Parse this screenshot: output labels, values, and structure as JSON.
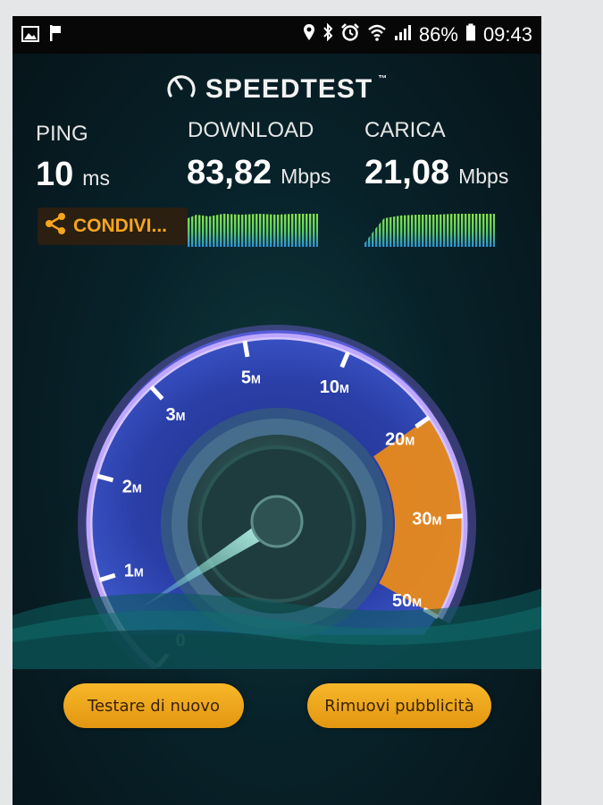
{
  "status_bar": {
    "battery": "86%",
    "time": "09:43",
    "left_icons": [
      "image-icon",
      "flag-icon"
    ],
    "right_icons": [
      "location-icon",
      "bluetooth-icon",
      "alarm-icon",
      "wifi-icon",
      "signal-icon",
      "battery-icon"
    ]
  },
  "brand": {
    "name": "SPEEDTEST",
    "mark": "™"
  },
  "metrics": {
    "ping": {
      "label": "PING",
      "value": "10",
      "unit": "ms"
    },
    "download": {
      "label": "DOWNLOAD",
      "value": "83,82",
      "unit": "Mbps"
    },
    "upload": {
      "label": "CARICA",
      "value": "21,08",
      "unit": "Mbps"
    }
  },
  "share": {
    "label": "CONDIVI..."
  },
  "gauge": {
    "ticks": [
      {
        "value": "0",
        "unit": ""
      },
      {
        "value": "1",
        "unit": "M"
      },
      {
        "value": "2",
        "unit": "M"
      },
      {
        "value": "3",
        "unit": "M"
      },
      {
        "value": "5",
        "unit": "M"
      },
      {
        "value": "10",
        "unit": "M"
      },
      {
        "value": "20",
        "unit": "M"
      },
      {
        "value": "30",
        "unit": "M"
      },
      {
        "value": "50",
        "unit": "M"
      }
    ],
    "colors": {
      "dial_fill": "#2b3fa8",
      "ring": "#d8c6ff",
      "orange_zone": "#e98a1c",
      "needle": "#7ff0df"
    }
  },
  "buttons": {
    "retest": "Testare di nuovo",
    "remove_ads": "Rimuovi pubblicità"
  },
  "colors": {
    "accent": "#f5a51e",
    "graph_green": "#7ee04a",
    "graph_blue": "#2b8fd6"
  }
}
